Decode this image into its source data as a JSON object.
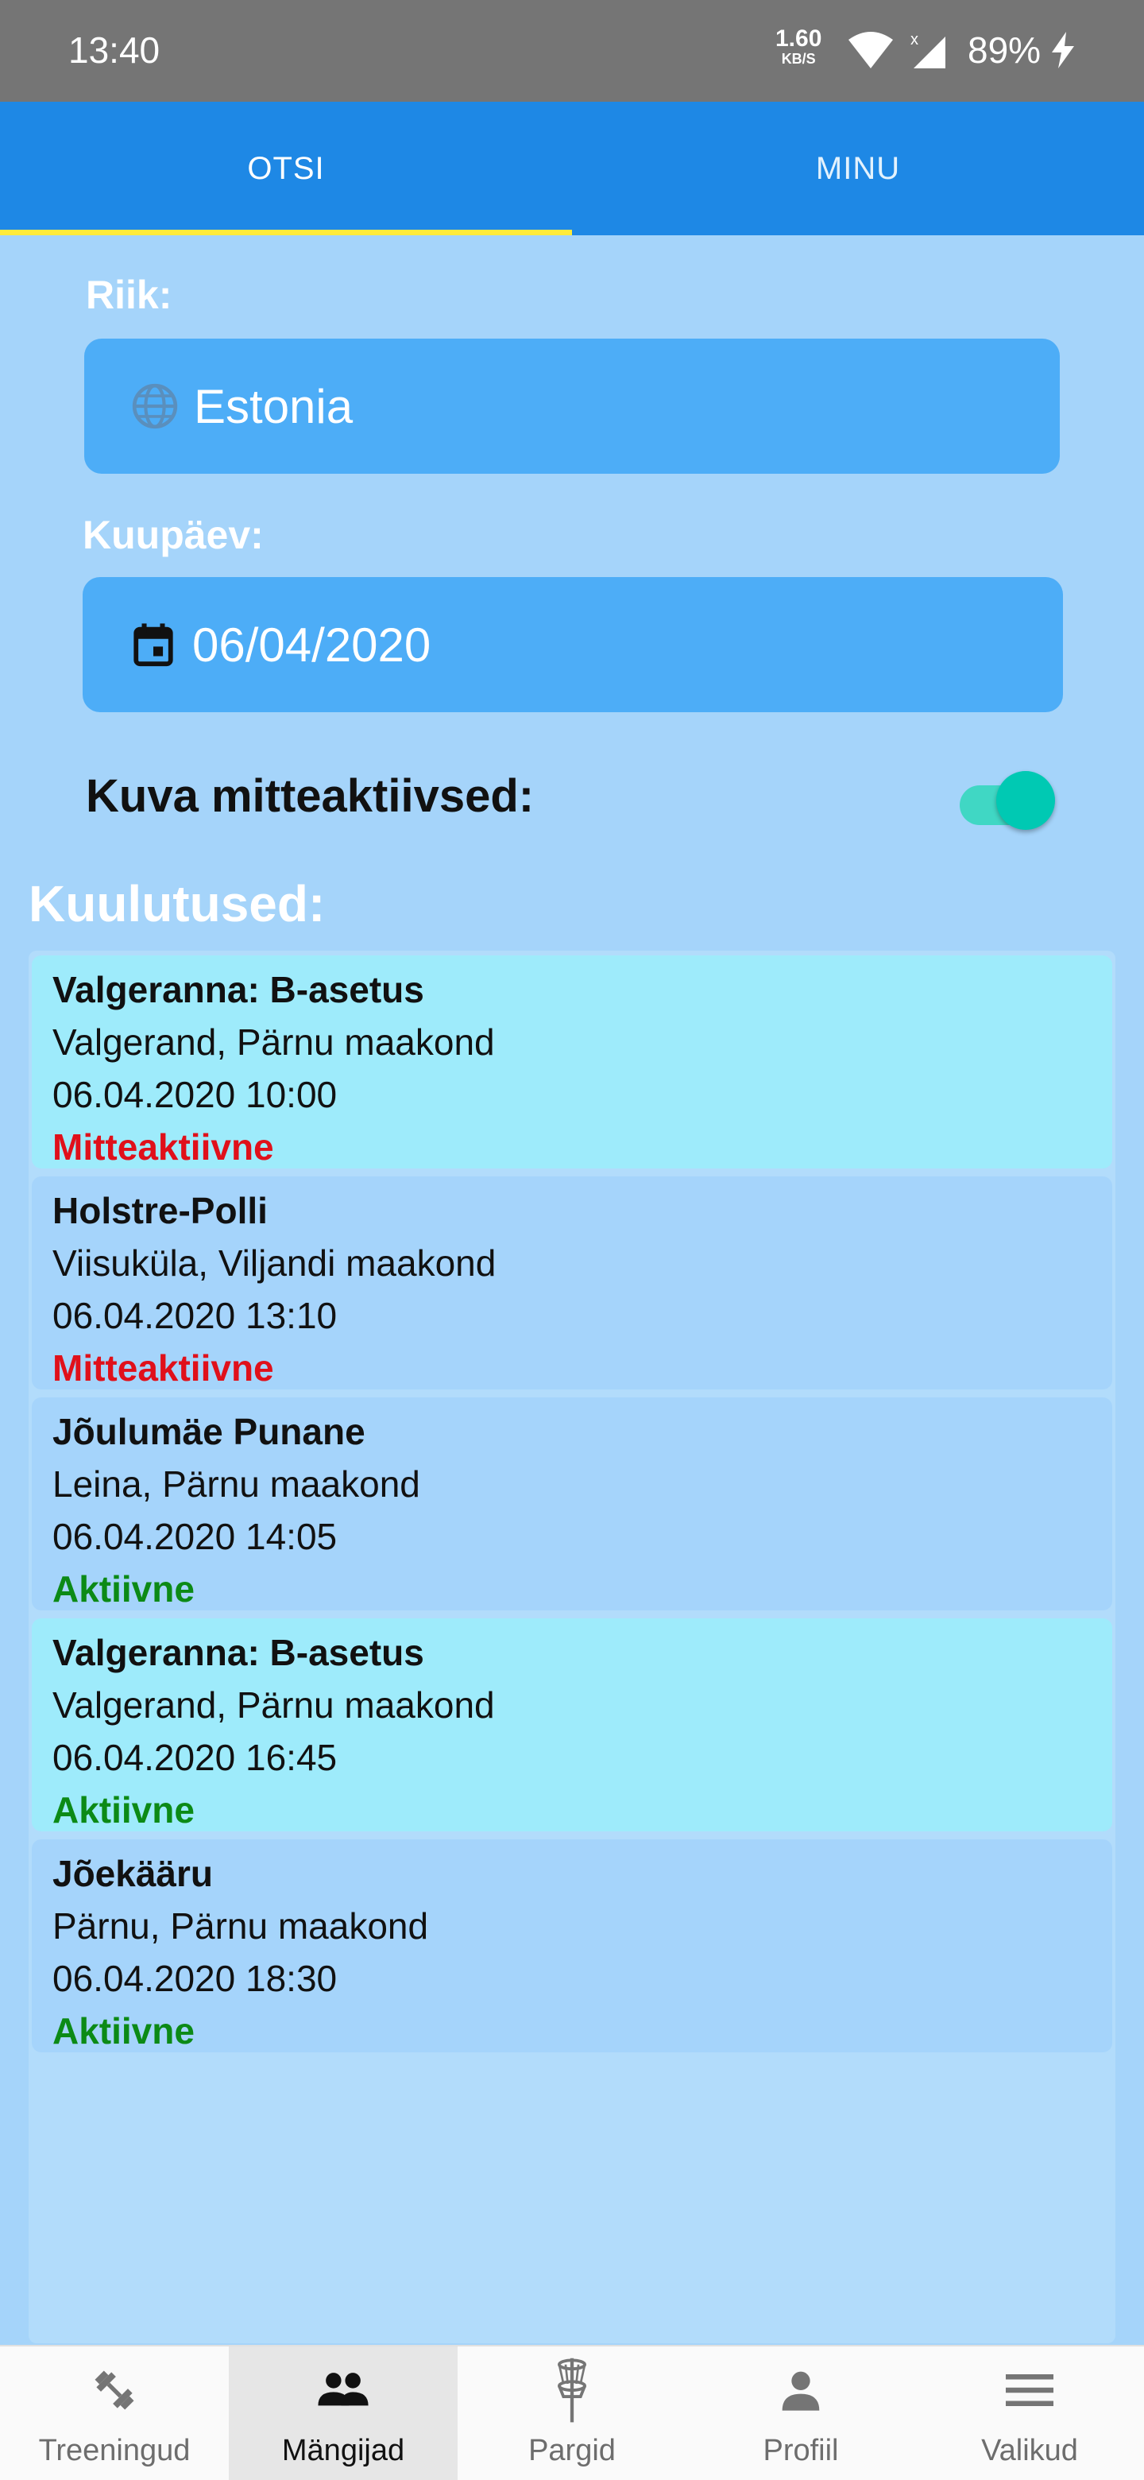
{
  "status_bar": {
    "time": "13:40",
    "speed_value": "1.60",
    "speed_unit": "KB/S",
    "battery": "89%",
    "icons": [
      "wifi-icon",
      "signal-icon",
      "charging-icon"
    ]
  },
  "tabs": [
    {
      "label": "OTSI",
      "active": true
    },
    {
      "label": "MINU",
      "active": false
    }
  ],
  "form": {
    "country_label": "Riik:",
    "country_value": "Estonia",
    "country_icon": "globe-icon",
    "date_label": "Kuupäev:",
    "date_value": "06/04/2020",
    "date_icon": "calendar-icon",
    "toggle_label": "Kuva mitteaktiivsed:",
    "toggle_on": true
  },
  "listings_title": "Kuulutused:",
  "listings": [
    {
      "title": "Valgeranna: B-asetus",
      "location": "Valgerand, Pärnu maakond",
      "datetime": "06.04.2020 10:00",
      "status": "Mitteaktiivne",
      "status_type": "inactive",
      "highlight": true
    },
    {
      "title": "Holstre-Polli",
      "location": "Viisuküla, Viljandi maakond",
      "datetime": "06.04.2020 13:10",
      "status": "Mitteaktiivne",
      "status_type": "inactive",
      "highlight": false
    },
    {
      "title": "Jõulumäe Punane",
      "location": "Leina, Pärnu maakond",
      "datetime": "06.04.2020 14:05",
      "status": "Aktiivne",
      "status_type": "active",
      "highlight": false
    },
    {
      "title": "Valgeranna: B-asetus",
      "location": "Valgerand, Pärnu maakond",
      "datetime": "06.04.2020 16:45",
      "status": "Aktiivne",
      "status_type": "active",
      "highlight": true
    },
    {
      "title": "Jõekääru",
      "location": "Pärnu, Pärnu maakond",
      "datetime": "06.04.2020 18:30",
      "status": "Aktiivne",
      "status_type": "active",
      "highlight": false
    }
  ],
  "bottom_nav": [
    {
      "label": "Treeningud",
      "icon": "dumbbell-icon",
      "active": false
    },
    {
      "label": "Mängijad",
      "icon": "people-icon",
      "active": true
    },
    {
      "label": "Pargid",
      "icon": "disc-golf-basket-icon",
      "active": false
    },
    {
      "label": "Profiil",
      "icon": "person-icon",
      "active": false
    },
    {
      "label": "Valikud",
      "icon": "menu-icon",
      "active": false
    }
  ],
  "colors": {
    "primary": "#1e88e5",
    "tab_indicator": "#ffeb3b",
    "background": "#a5d4fa",
    "field": "#4dadf7",
    "toggle": "#00c9b3",
    "inactive_status": "#e0101a",
    "active_status": "#0c8a16",
    "highlight_card": "#9eebfb"
  }
}
